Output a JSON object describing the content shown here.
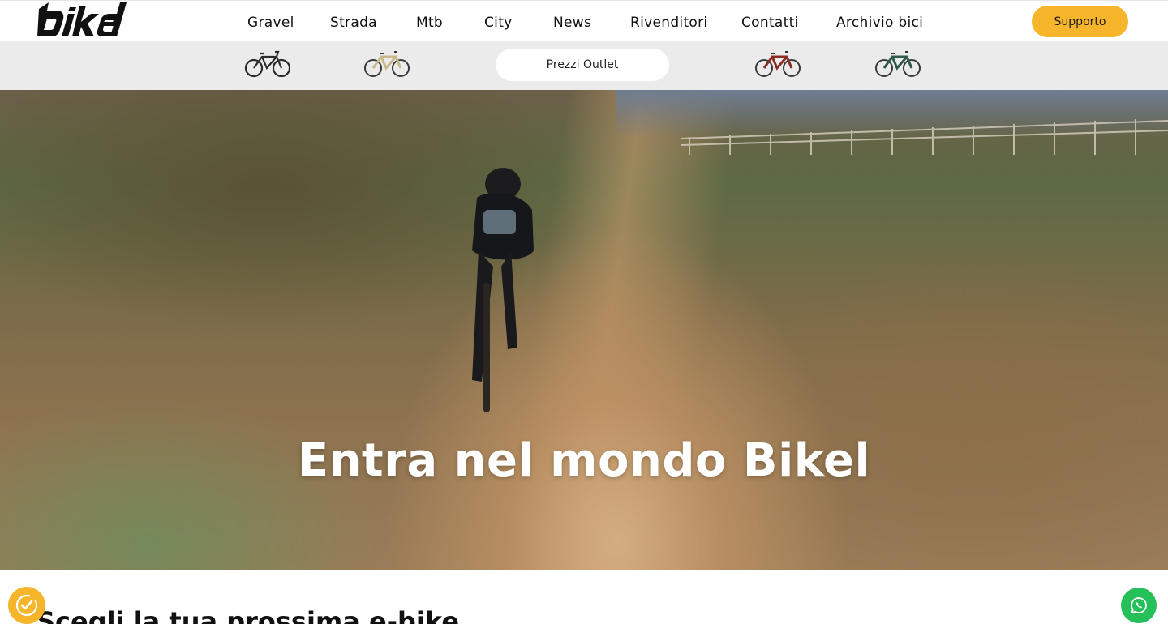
{
  "brand": {
    "logo_text": "bikel"
  },
  "nav": {
    "items": [
      "Gravel",
      "Strada",
      "Mtb",
      "City",
      "News",
      "Rivenditori",
      "Contatti",
      "Archivio bici"
    ]
  },
  "header": {
    "support_label": "Supporto"
  },
  "subbar": {
    "outlet_label": "Prezzi Outlet",
    "bikes": [
      {
        "icon": "bike-black-icon",
        "color": "#2a2a2a"
      },
      {
        "icon": "bike-beige-icon",
        "color": "#c9b88a"
      },
      {
        "icon": "bike-red-icon",
        "color": "#8a2c22"
      },
      {
        "icon": "bike-green-icon",
        "color": "#2f5a4a"
      }
    ]
  },
  "hero": {
    "title": "Entra nel mondo Bikel"
  },
  "section": {
    "title": "Scegli la tua prossima e-bike"
  },
  "colors": {
    "accent": "#f6b52a",
    "whatsapp": "#25c05a"
  }
}
